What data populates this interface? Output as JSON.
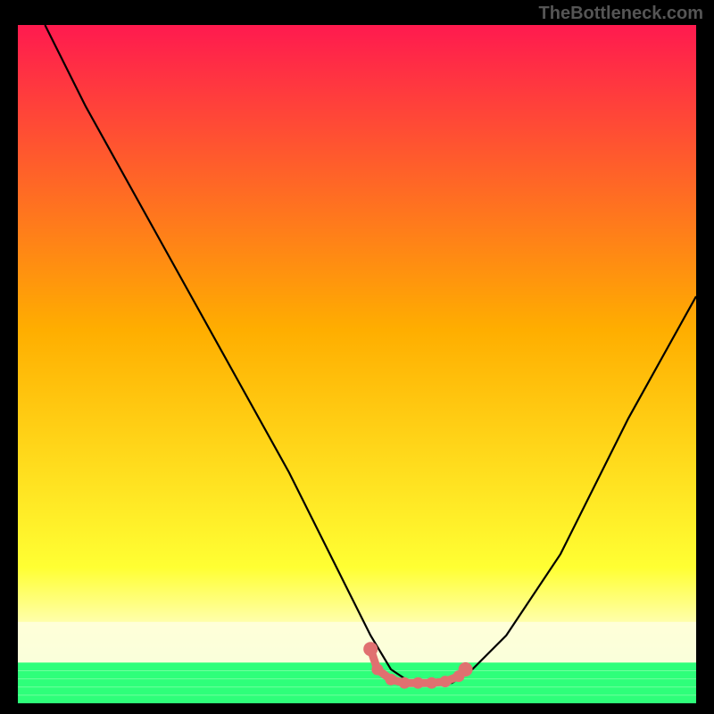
{
  "watermark": "TheBottleneck.com",
  "chart_data": {
    "type": "line",
    "title": "",
    "xlabel": "",
    "ylabel": "",
    "xlim": [
      0,
      100
    ],
    "ylim": [
      0,
      100
    ],
    "background_gradient": {
      "top": "#ff1a4f",
      "mid1": "#ffae00",
      "mid2": "#ffff33",
      "bottom": "#2eff7a"
    },
    "series": [
      {
        "name": "bottleneck-curve",
        "color": "#000000",
        "x": [
          4,
          10,
          20,
          30,
          40,
          48,
          52,
          55,
          58,
          61,
          64,
          67,
          72,
          80,
          90,
          100
        ],
        "y": [
          100,
          88,
          70,
          52,
          34,
          18,
          10,
          5,
          3,
          3,
          3,
          5,
          10,
          22,
          42,
          60
        ]
      }
    ],
    "annotations": [
      {
        "name": "sweet-spot-markers",
        "color": "#e07070",
        "points": [
          {
            "x": 52,
            "y": 8
          },
          {
            "x": 53,
            "y": 5
          },
          {
            "x": 55,
            "y": 3.5
          },
          {
            "x": 57,
            "y": 3
          },
          {
            "x": 59,
            "y": 3
          },
          {
            "x": 61,
            "y": 3
          },
          {
            "x": 63,
            "y": 3.2
          },
          {
            "x": 65,
            "y": 4
          },
          {
            "x": 66,
            "y": 5
          }
        ]
      }
    ],
    "green_band": {
      "y_from": 0,
      "y_to": 6
    },
    "white_band": {
      "y_from": 6,
      "y_to": 12
    }
  }
}
